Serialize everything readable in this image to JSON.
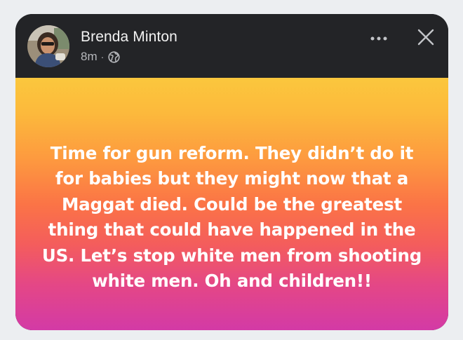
{
  "post": {
    "author_name": "Brenda Minton",
    "timestamp": "8m",
    "separator": "·",
    "privacy_icon": "globe-icon",
    "text": "Time for gun reform. They didn’t do it for babies but they might now that a Maggat died. Could be the greatest thing that could have happened in the US. Let’s stop white men from shooting white men. Oh and children!!",
    "background_gradient": [
      "#fbc73d",
      "#fd9a3f",
      "#fb7446",
      "#e44786",
      "#d33aa6"
    ]
  },
  "header": {
    "background": "#232427",
    "more_icon": "more-horizontal-icon",
    "close_icon": "close-icon"
  }
}
